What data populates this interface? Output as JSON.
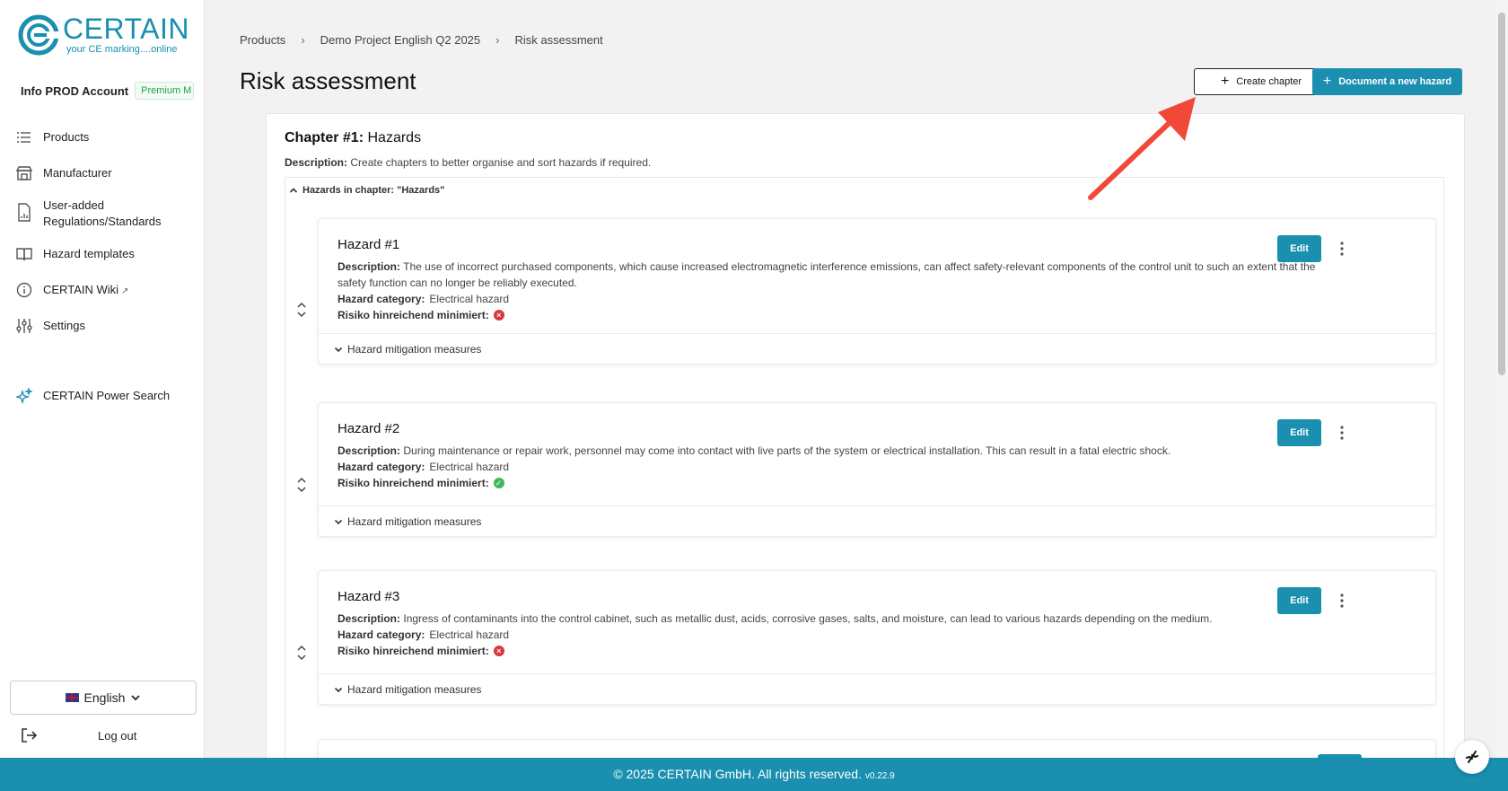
{
  "brand": {
    "name": "CERTAIN",
    "tagline": "your CE marking....online"
  },
  "account": {
    "name": "Info PROD Account",
    "plan_badge": "Premium M"
  },
  "sidebar": {
    "items": [
      {
        "label": "Products",
        "icon": "list-icon"
      },
      {
        "label": "Manufacturer",
        "icon": "building-icon"
      },
      {
        "label": "User-added",
        "label2": "Regulations/Standards",
        "icon": "document-icon"
      },
      {
        "label": "Hazard templates",
        "icon": "book-icon"
      },
      {
        "label": "CERTAIN Wiki",
        "icon": "info-icon",
        "external": "external-link-icon"
      },
      {
        "label": "Settings",
        "icon": "sliders-icon"
      },
      {
        "label": "CERTAIN Power Search",
        "icon": "sparkles-icon"
      }
    ],
    "language": "English",
    "logout": "Log out"
  },
  "breadcrumb": [
    "Products",
    "Demo Project English Q2 2025",
    "Risk assessment"
  ],
  "page": {
    "title": "Risk assessment",
    "create_chapter": "Create chapter",
    "document_hazard": "Document a new hazard"
  },
  "chapter": {
    "title_prefix": "Chapter #1:",
    "title": "Hazards",
    "desc_label": "Description:",
    "desc": "Create chapters to better organise and sort hazards if required.",
    "section_label": "Hazards in chapter: \"Hazards\""
  },
  "labels": {
    "description": "Description:",
    "category": "Hazard category:",
    "risk": "Risiko hinreichend minimiert:",
    "edit": "Edit",
    "mitigation": "Hazard mitigation measures"
  },
  "hazards": [
    {
      "title": "Hazard #1",
      "description": "The use of incorrect purchased components, which cause increased electromagnetic interference emissions, can affect safety-relevant components of the control unit to such an extent that the safety function can no longer be reliably executed.",
      "category": "Electrical hazard",
      "risk_minimized": false
    },
    {
      "title": "Hazard #2",
      "description": "During maintenance or repair work, personnel may come into contact with live parts of the system or electrical installation. This can result in a fatal electric shock.",
      "category": "Electrical hazard",
      "risk_minimized": true
    },
    {
      "title": "Hazard #3",
      "description": "Ingress of contaminants into the control cabinet, such as metallic dust, acids, corrosive gases, salts, and moisture, can lead to various hazards depending on the medium.",
      "category": "Electrical hazard",
      "risk_minimized": false
    }
  ],
  "footer": {
    "text": "© 2025 CERTAIN GmbH. All rights reserved.",
    "version": "v0.22.9"
  },
  "colors": {
    "primary": "#1a8fb0",
    "danger": "#d9363e",
    "success": "#3cb95b",
    "annotation": "#f0493a"
  }
}
